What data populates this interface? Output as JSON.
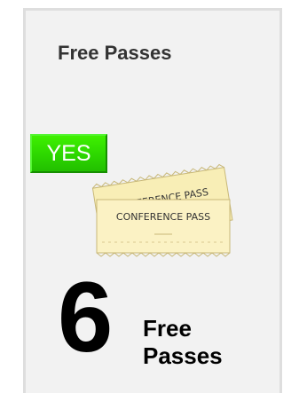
{
  "card": {
    "title": "Free Passes",
    "badge": "YES",
    "ticket_text": "CONFERENCE PASS",
    "number": "6",
    "label_line1": "Free",
    "label_line2": "Passes"
  }
}
